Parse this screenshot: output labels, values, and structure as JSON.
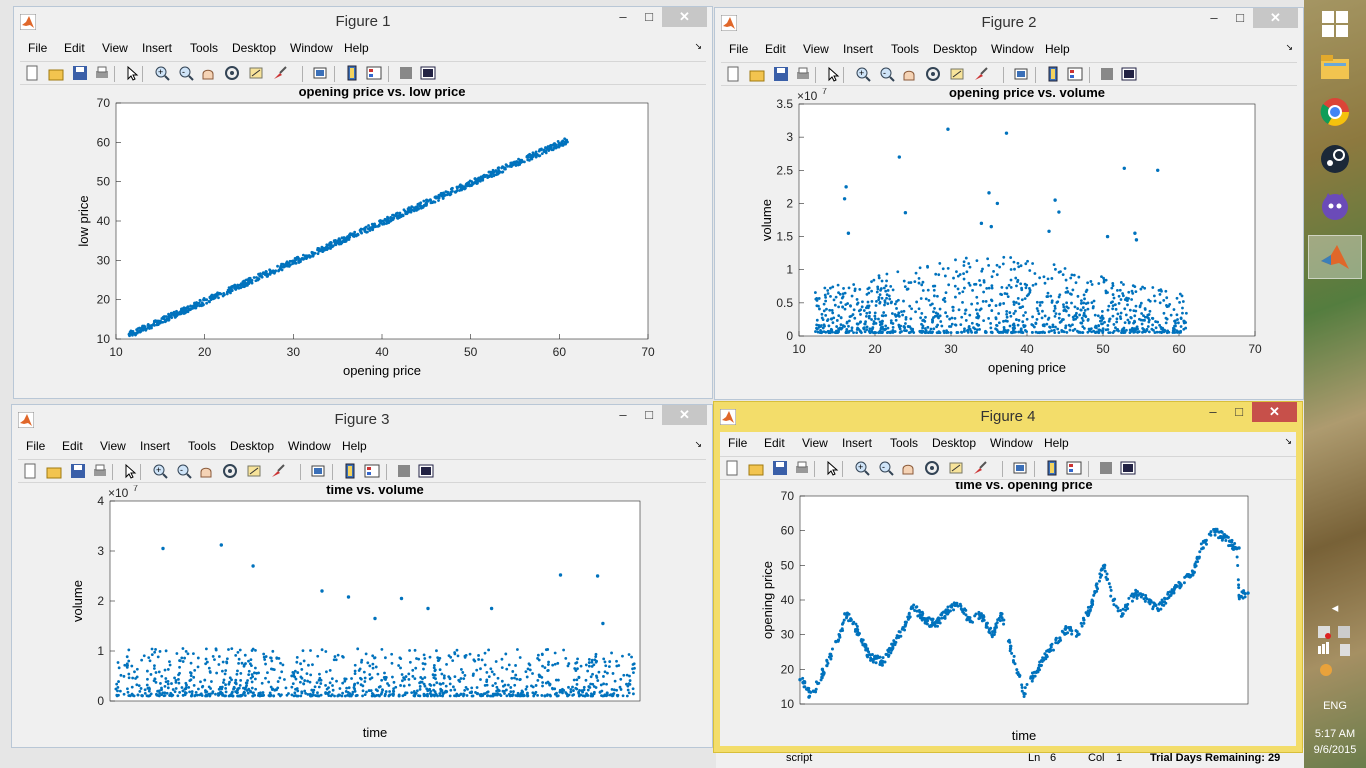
{
  "menu": [
    "File",
    "Edit",
    "View",
    "Insert",
    "Tools",
    "Desktop",
    "Window",
    "Help"
  ],
  "taskbar": {
    "lang": "ENG",
    "time": "5:17 AM",
    "date": "9/6/2015"
  },
  "background": {
    "status_script": "script",
    "status_ln": "Ln",
    "status_ln_val": "6",
    "status_col": "Col",
    "status_col_val": "1",
    "status_trial": "Trial Days Remaining: 29"
  },
  "figures": [
    {
      "title": "Figure 1"
    },
    {
      "title": "Figure 2"
    },
    {
      "title": "Figure 3"
    },
    {
      "title": "Figure 4"
    }
  ],
  "colors": {
    "marker": "#0072bd",
    "active_frame": "#f3dd6a",
    "close": "#c7504a"
  },
  "chart_data": [
    {
      "type": "scatter",
      "title": "opening price vs. low price",
      "xlabel": "opening price",
      "ylabel": "low price",
      "xlim": [
        10,
        70
      ],
      "ylim": [
        10,
        70
      ],
      "xticks": [
        "10",
        "20",
        "30",
        "40",
        "50",
        "60",
        "70"
      ],
      "yticks": [
        "10",
        "20",
        "30",
        "40",
        "50",
        "60",
        "70"
      ],
      "exponent": "",
      "description_of_points": "approximately y = x - 0.5 tightly clustered",
      "x": [
        11.5,
        13,
        15,
        17,
        19,
        21,
        23,
        25,
        27,
        29,
        31,
        33,
        35,
        37,
        39,
        41,
        43,
        45,
        47,
        49,
        51,
        53,
        55,
        57,
        59,
        60.8
      ],
      "y": [
        11.2,
        12.6,
        14.5,
        16.6,
        18.5,
        20.5,
        22.5,
        24.5,
        26.4,
        28.5,
        30.4,
        32.5,
        34.5,
        36.4,
        38.5,
        40.4,
        42.5,
        44.4,
        46.5,
        48.4,
        50.5,
        52.4,
        54.5,
        56.4,
        58.5,
        60.5
      ]
    },
    {
      "type": "scatter",
      "title": "opening price vs. volume",
      "xlabel": "opening price",
      "ylabel": "volume",
      "xlim": [
        10,
        70
      ],
      "ylim": [
        0,
        3.5
      ],
      "xticks": [
        "10",
        "20",
        "30",
        "40",
        "50",
        "60",
        "70"
      ],
      "yticks": [
        "0",
        "0.5",
        "1",
        "1.5",
        "2",
        "2.5",
        "3",
        "3.5"
      ],
      "exponent": "7",
      "x": [
        29.6,
        37.3,
        23.2,
        52.8,
        57.2,
        16.2,
        16.0,
        35.0,
        36.1,
        43.7,
        24.0,
        44.2,
        50.6,
        54.2,
        54.4,
        16.5,
        42.9,
        34.0,
        35.3
      ],
      "y": [
        3.12,
        3.06,
        2.7,
        2.53,
        2.5,
        2.25,
        2.07,
        2.16,
        2.0,
        2.05,
        1.86,
        1.87,
        1.5,
        1.55,
        1.45,
        1.55,
        1.58,
        1.7,
        1.65
      ]
    },
    {
      "type": "scatter",
      "title": "time vs. volume",
      "xlabel": "time",
      "ylabel": "volume",
      "xlim": [
        0,
        1
      ],
      "ylim": [
        0,
        4
      ],
      "xticks": [],
      "yticks": [
        "0",
        "1",
        "2",
        "3",
        "4"
      ],
      "exponent": "7",
      "x": [
        0.1,
        0.21,
        0.27,
        0.4,
        0.45,
        0.5,
        0.55,
        0.6,
        0.72,
        0.85,
        0.92,
        0.93
      ],
      "y": [
        3.05,
        3.12,
        2.7,
        2.2,
        2.08,
        1.65,
        2.05,
        1.85,
        1.85,
        2.52,
        2.5,
        1.55
      ]
    },
    {
      "type": "scatter",
      "title": "time vs. opening price",
      "xlabel": "time",
      "ylabel": "opening price",
      "xlim": [
        0,
        1
      ],
      "ylim": [
        10,
        70
      ],
      "xticks": [],
      "yticks": [
        "10",
        "20",
        "30",
        "40",
        "50",
        "60",
        "70"
      ],
      "exponent": "",
      "x": [
        0.0,
        0.02,
        0.05,
        0.08,
        0.1,
        0.13,
        0.15,
        0.18,
        0.2,
        0.23,
        0.25,
        0.28,
        0.3,
        0.33,
        0.35,
        0.38,
        0.4,
        0.43,
        0.45,
        0.47,
        0.5,
        0.52,
        0.55,
        0.58,
        0.6,
        0.62,
        0.65,
        0.68,
        0.7,
        0.72,
        0.75,
        0.78,
        0.8,
        0.83,
        0.85,
        0.88,
        0.9,
        0.93,
        0.96,
        0.98,
        0.985,
        1.0
      ],
      "y": [
        17,
        12,
        20,
        28,
        36,
        30,
        24,
        22,
        26,
        32,
        38,
        34,
        33,
        37,
        39,
        34,
        36,
        30,
        36,
        26,
        13,
        18,
        24,
        29,
        32,
        30,
        38,
        50,
        40,
        36,
        42,
        40,
        37,
        42,
        44,
        48,
        55,
        60,
        57,
        55,
        41,
        42
      ]
    }
  ]
}
